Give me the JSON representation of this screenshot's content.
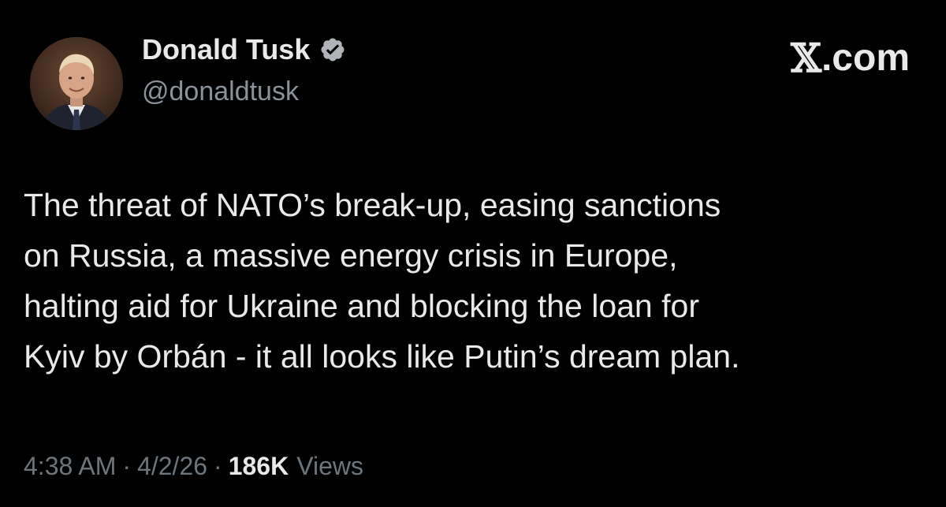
{
  "author": {
    "display_name": "Donald Tusk",
    "handle": "@donaldtusk",
    "verified": true
  },
  "brand": {
    "x_glyph": "𝕏",
    "suffix": ".com"
  },
  "tweet": {
    "text": "The threat of NATO’s break-up, easing sanctions\non Russia, a massive energy crisis in Europe,\nhalting aid for Ukraine and blocking the loan for\nKyiv by Orbán - it all looks like Putin’s dream plan."
  },
  "meta": {
    "time": "4:38 AM",
    "separator": "·",
    "date": "4/2/26",
    "views_count": "186K",
    "views_label": "Views"
  },
  "colors": {
    "background": "#000000",
    "primary_text": "#e7e9ea",
    "secondary_text": "#6e767d",
    "verified_badge": "#b0b3b8"
  },
  "icons": {
    "verified": "verified-badge-icon",
    "avatar": "profile-photo"
  }
}
